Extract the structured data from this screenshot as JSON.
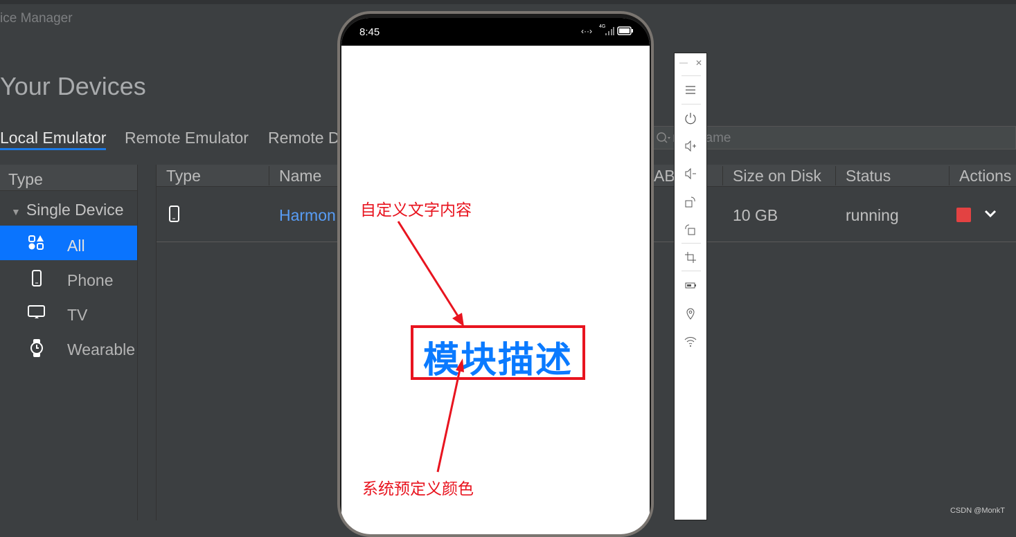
{
  "window": {
    "title": "ice Manager"
  },
  "page": {
    "heading": "Your Devices"
  },
  "tabs": [
    {
      "label": "Local Emulator",
      "active": true
    },
    {
      "label": "Remote Emulator"
    },
    {
      "label": "Remote D"
    }
  ],
  "search": {
    "placeholder": "r by name"
  },
  "sidebar": {
    "header": "Type",
    "group": "Single Device",
    "items": [
      {
        "label": "All",
        "icon": "all-categories-icon",
        "selected": true
      },
      {
        "label": "Phone",
        "icon": "phone-icon"
      },
      {
        "label": "TV",
        "icon": "tv-icon"
      },
      {
        "label": "Wearable",
        "icon": "watch-icon"
      }
    ]
  },
  "table": {
    "columns": [
      "Type",
      "Name",
      "AB",
      "Size on Disk",
      "Status",
      "Actions"
    ],
    "rows": [
      {
        "type_icon": "phone-icon",
        "name": "Harmon",
        "size": "10 GB",
        "status": "running"
      }
    ]
  },
  "emulator": {
    "time": "8:45",
    "network": "4G"
  },
  "toolbar": {
    "icons": [
      "minimize-icon",
      "close-icon",
      "menu-icon",
      "power-icon",
      "volume-up-icon",
      "volume-down-icon",
      "rotate-right-icon",
      "rotate-left-icon",
      "crop-icon",
      "battery-icon",
      "location-icon",
      "wifi-icon"
    ]
  },
  "annotation": {
    "content": "模块描述",
    "top_label": "自定义文字内容",
    "bottom_label": "系统预定义颜色"
  },
  "watermark": "CSDN @MonkT",
  "colors": {
    "accent": "#0a74fe",
    "link": "#589df6",
    "stop": "#e34242",
    "annotation_red": "#e8141f",
    "text_blue": "#0a7aff"
  }
}
